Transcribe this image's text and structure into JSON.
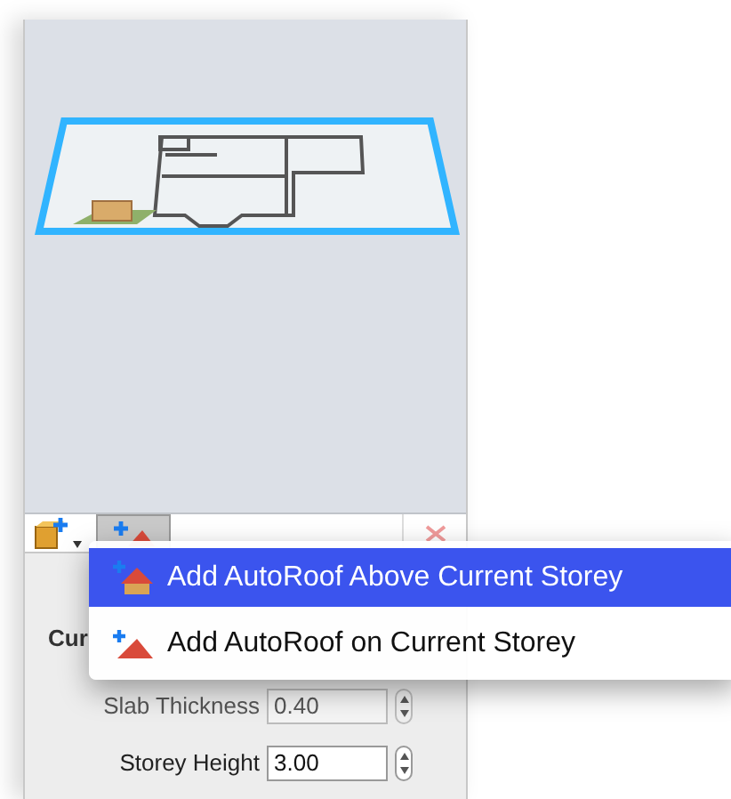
{
  "toolbar": {
    "buttons": [
      {
        "kind": "storey",
        "selected": false
      },
      {
        "kind": "autoroof",
        "selected": true
      },
      {
        "kind": "delete",
        "selected": false
      }
    ]
  },
  "menu": {
    "items": [
      {
        "label": "Add AutoRoof Above Current Storey",
        "kind": "above",
        "selected": true
      },
      {
        "label": "Add AutoRoof on Current Storey",
        "kind": "on",
        "selected": false
      }
    ]
  },
  "properties": {
    "heading": "Cur",
    "fields": [
      {
        "label": "Slab Thickness",
        "value": "0.40",
        "disabled": true
      },
      {
        "label": "Storey Height",
        "value": "3.00",
        "disabled": false
      }
    ]
  }
}
